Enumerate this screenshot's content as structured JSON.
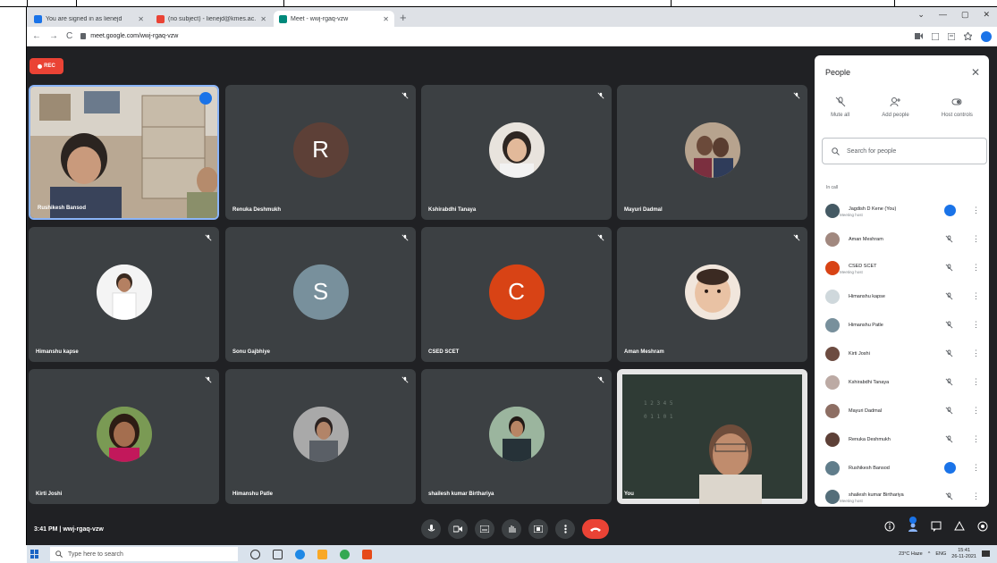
{
  "browser": {
    "tabs": [
      {
        "label": "You are signed in as lienejd",
        "favicon_color": "#1a73e8"
      },
      {
        "label": "(no subject) - lienejd@kmes.ac.",
        "favicon_color": "#ea4335"
      },
      {
        "label": "Meet - wwj-rgaq-vzw",
        "favicon_color": "#00897b",
        "active": true
      }
    ],
    "tab_close": "✕",
    "new_tab": "+",
    "window_controls": [
      "⌄",
      "—",
      "▢",
      "✕"
    ],
    "nav_back": "←",
    "nav_forward": "→",
    "nav_reload": "C",
    "url": "meet.google.com/wwj-rgaq-vzw"
  },
  "meet": {
    "rec_label": "REC",
    "tiles": [
      {
        "name": "Rushikesh Bansod",
        "type": "video",
        "speaking": true
      },
      {
        "name": "Renuka Deshmukh",
        "type": "letter",
        "letter": "R",
        "color": "#5d4037"
      },
      {
        "name": "Kshirabdhi Tanaya",
        "type": "photo",
        "color": "#c9b8a8"
      },
      {
        "name": "Mayuri Dadmal",
        "type": "photo",
        "color": "#8d6e63"
      },
      {
        "name": "Himanshu kapse",
        "type": "photo",
        "color": "#e0e0e0"
      },
      {
        "name": "Sonu Gajbhiye",
        "type": "letter",
        "letter": "S",
        "color": "#78909c"
      },
      {
        "name": "CSED SCET",
        "type": "letter",
        "letter": "C",
        "color": "#d84315"
      },
      {
        "name": "Aman Meshram",
        "type": "photo",
        "color": "#d7b49e"
      },
      {
        "name": "Kirti Joshi",
        "type": "photo",
        "color": "#5d4037"
      },
      {
        "name": "Himanshu Patle",
        "type": "photo",
        "color": "#9e9e9e"
      },
      {
        "name": "shailesh kumar Birthariya",
        "type": "photo",
        "color": "#6d8b74"
      },
      {
        "name": "You",
        "type": "video-self"
      }
    ],
    "meeting_time": "3:41 PM",
    "meeting_code": "wwj-rgaq-vzw"
  },
  "people_panel": {
    "title": "People",
    "close": "✕",
    "actions": [
      {
        "label": "Mute all",
        "icon": "mic-off-icon"
      },
      {
        "label": "Add people",
        "icon": "person-add-icon"
      },
      {
        "label": "Host controls",
        "icon": "host-controls-icon"
      }
    ],
    "search_placeholder": "Search for people",
    "section_label": "In call",
    "participants": [
      {
        "name": "Jagdish D Kene (You)",
        "sub": "Meeting host",
        "color": "#455a64",
        "speaking": true
      },
      {
        "name": "Aman Meshram",
        "sub": "",
        "color": "#a1887f"
      },
      {
        "name": "CSED SCET",
        "sub": "Meeting host",
        "color": "#d84315"
      },
      {
        "name": "Himanshu kapse",
        "sub": "",
        "color": "#cfd8dc"
      },
      {
        "name": "Himanshu Patle",
        "sub": "",
        "color": "#78909c"
      },
      {
        "name": "Kirti Joshi",
        "sub": "",
        "color": "#6d4c41"
      },
      {
        "name": "Kshirabdhi Tanaya",
        "sub": "",
        "color": "#bcaaa4"
      },
      {
        "name": "Mayuri Dadmal",
        "sub": "",
        "color": "#8d6e63"
      },
      {
        "name": "Renuka Deshmukh",
        "sub": "",
        "color": "#5d4037"
      },
      {
        "name": "Rushikesh Bansod",
        "sub": "",
        "color": "#607d8b",
        "speaking": true
      },
      {
        "name": "shailesh kumar Birthariya",
        "sub": "Meeting host",
        "color": "#546e7a"
      }
    ]
  },
  "taskbar": {
    "search_placeholder": "Type here to search",
    "weather": "23°C Haze",
    "lang": "ENG",
    "time": "15:41",
    "date": "26-11-2021"
  }
}
